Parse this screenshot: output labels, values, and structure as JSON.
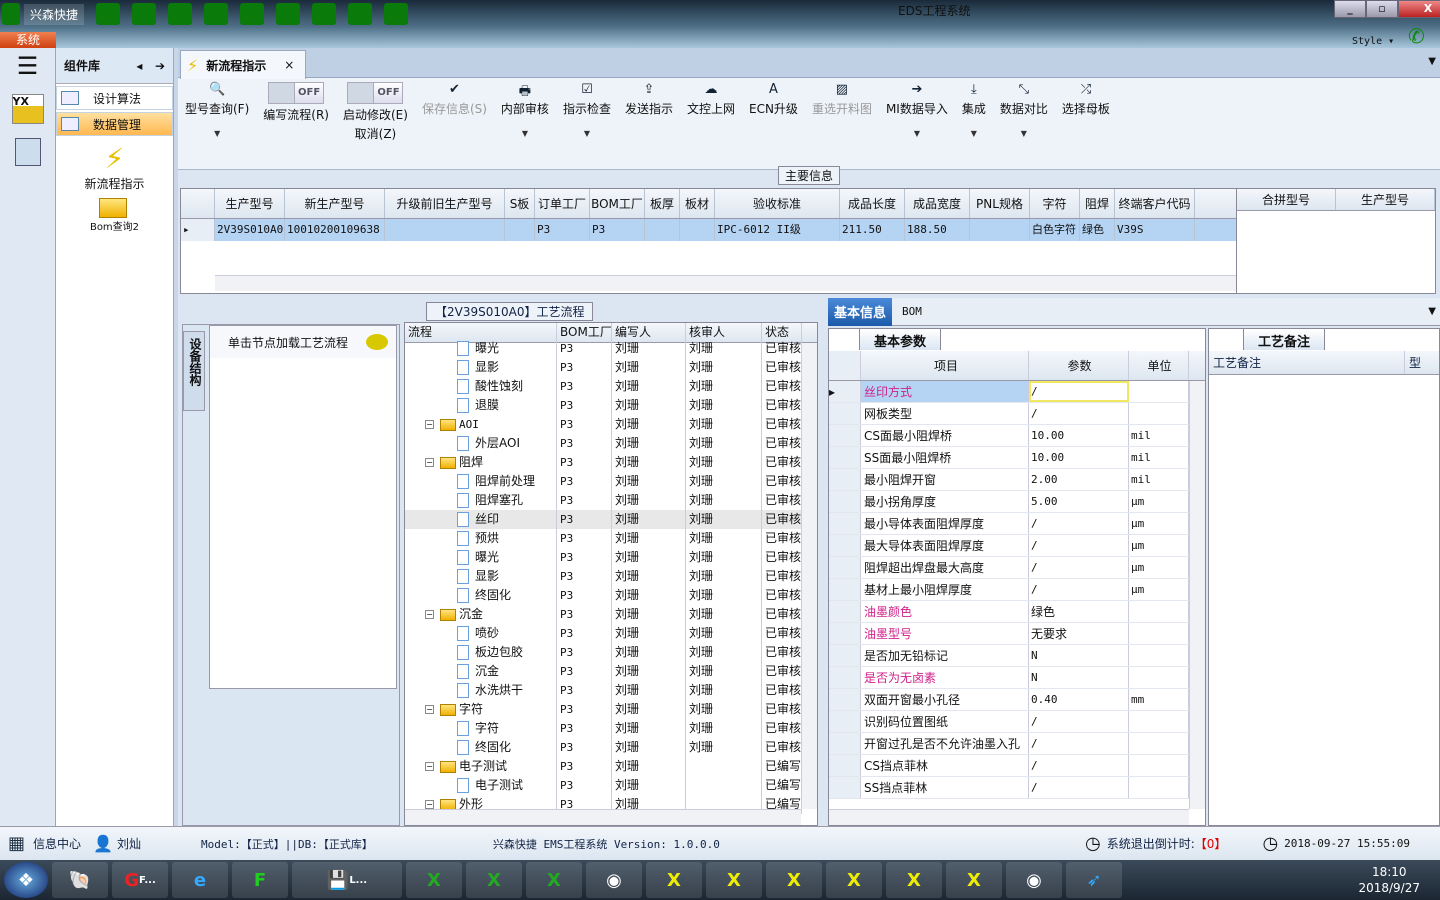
{
  "window": {
    "app_name": "兴森快捷",
    "title": "EDS工程系统",
    "system_tab": "系统",
    "style_label": "Style",
    "minimize": "_",
    "restore": "▫",
    "close": "X"
  },
  "quick_access_icons": [
    "search-icon",
    "lifebuoy-icon",
    "grid-icon",
    "scissors-icon",
    "film-icon",
    "copy-icon",
    "table-icon",
    "user-icon",
    "area-chart-icon"
  ],
  "component_panel": {
    "title": "组件库",
    "items": [
      {
        "label": "设计算法"
      },
      {
        "label": "数据管理",
        "selected": true
      }
    ],
    "big_items": [
      {
        "label": "新流程指示",
        "icon": "lightning-icon"
      },
      {
        "label": "Bom查询2",
        "icon": "folder-icon"
      }
    ]
  },
  "tab": {
    "label": "新流程指示",
    "close": "×"
  },
  "ribbon": {
    "buttons": [
      {
        "label": "型号查询(F)",
        "icon": "🔍",
        "dropdown": true
      },
      {
        "label": "编写流程(R)",
        "toggle": "OFF"
      },
      {
        "label": "启动修改(E)",
        "label2": "取消(Z)",
        "toggle": "OFF"
      },
      {
        "label": "保存信息(S)",
        "icon": "✔",
        "disabled": true
      },
      {
        "label": "内部审核",
        "icon": "🖶",
        "dropdown": true
      },
      {
        "label": "指示检查",
        "icon": "☑",
        "dropdown": true
      },
      {
        "label": "发送指示",
        "icon": "⇪"
      },
      {
        "label": "文控上网",
        "icon": "☁"
      },
      {
        "label": "ECN升级",
        "icon": "A"
      },
      {
        "label": "重选开料图",
        "icon": "▨",
        "disabled": true
      },
      {
        "label": "MI数据导入",
        "icon": "➔",
        "dropdown": true
      },
      {
        "label": "集成",
        "icon": "⤓",
        "dropdown": true
      },
      {
        "label": "数据对比",
        "icon": "⤡",
        "dropdown": true
      },
      {
        "label": "选择母板",
        "icon": "⤮"
      }
    ]
  },
  "main_info": {
    "group_label": "主要信息",
    "columns": [
      "生产型号",
      "新生产型号",
      "升级前旧生产型号",
      "S板",
      "订单工厂",
      "BOM工厂",
      "板厚",
      "板材",
      "验收标准",
      "成品长度",
      "成品宽度",
      "PNL规格",
      "字符",
      "阻焊",
      "终端客户代码"
    ],
    "rows": [
      [
        "2V39S010A0",
        "10010200109638",
        "",
        "",
        "P3",
        "P3",
        "",
        "",
        "IPC-6012 II级",
        "211.50",
        "188.50",
        "",
        "白色字符",
        "绿色",
        "V39S"
      ]
    ],
    "side_columns": [
      "合拼型号",
      "生产型号"
    ]
  },
  "process": {
    "title": "【2V39S010A0】工艺流程",
    "side_tab": "设备结构",
    "node_label": "单击节点加载工艺流程",
    "columns": [
      "流程",
      "BOM工厂",
      "编写人",
      "核审人",
      "状态"
    ],
    "rows": [
      {
        "name": "曝光",
        "folder": false,
        "bom": "P3",
        "writer": "刘珊",
        "reviewer": "刘珊",
        "status": "已审核"
      },
      {
        "name": "显影",
        "folder": false,
        "bom": "P3",
        "writer": "刘珊",
        "reviewer": "刘珊",
        "status": "已审核"
      },
      {
        "name": "酸性蚀刻",
        "folder": false,
        "bom": "P3",
        "writer": "刘珊",
        "reviewer": "刘珊",
        "status": "已审核"
      },
      {
        "name": "退膜",
        "folder": false,
        "bom": "P3",
        "writer": "刘珊",
        "reviewer": "刘珊",
        "status": "已审核"
      },
      {
        "name": "AOI",
        "folder": true,
        "bom": "P3",
        "writer": "刘珊",
        "reviewer": "刘珊",
        "status": "已审核"
      },
      {
        "name": "外层AOI",
        "folder": false,
        "bom": "P3",
        "writer": "刘珊",
        "reviewer": "刘珊",
        "status": "已审核"
      },
      {
        "name": "阻焊",
        "folder": true,
        "bom": "P3",
        "writer": "刘珊",
        "reviewer": "刘珊",
        "status": "已审核"
      },
      {
        "name": "阻焊前处理",
        "folder": false,
        "bom": "P3",
        "writer": "刘珊",
        "reviewer": "刘珊",
        "status": "已审核"
      },
      {
        "name": "阻焊塞孔",
        "folder": false,
        "bom": "P3",
        "writer": "刘珊",
        "reviewer": "刘珊",
        "status": "已审核"
      },
      {
        "name": "丝印",
        "folder": false,
        "bom": "P3",
        "writer": "刘珊",
        "reviewer": "刘珊",
        "status": "已审核",
        "selected": true
      },
      {
        "name": "预烘",
        "folder": false,
        "bom": "P3",
        "writer": "刘珊",
        "reviewer": "刘珊",
        "status": "已审核"
      },
      {
        "name": "曝光",
        "folder": false,
        "bom": "P3",
        "writer": "刘珊",
        "reviewer": "刘珊",
        "status": "已审核"
      },
      {
        "name": "显影",
        "folder": false,
        "bom": "P3",
        "writer": "刘珊",
        "reviewer": "刘珊",
        "status": "已审核"
      },
      {
        "name": "终固化",
        "folder": false,
        "bom": "P3",
        "writer": "刘珊",
        "reviewer": "刘珊",
        "status": "已审核"
      },
      {
        "name": "沉金",
        "folder": true,
        "bom": "P3",
        "writer": "刘珊",
        "reviewer": "刘珊",
        "status": "已审核"
      },
      {
        "name": "喷砂",
        "folder": false,
        "bom": "P3",
        "writer": "刘珊",
        "reviewer": "刘珊",
        "status": "已审核"
      },
      {
        "name": "板边包胶",
        "folder": false,
        "bom": "P3",
        "writer": "刘珊",
        "reviewer": "刘珊",
        "status": "已审核"
      },
      {
        "name": "沉金",
        "folder": false,
        "bom": "P3",
        "writer": "刘珊",
        "reviewer": "刘珊",
        "status": "已审核"
      },
      {
        "name": "水洗烘干",
        "folder": false,
        "bom": "P3",
        "writer": "刘珊",
        "reviewer": "刘珊",
        "status": "已审核"
      },
      {
        "name": "字符",
        "folder": true,
        "bom": "P3",
        "writer": "刘珊",
        "reviewer": "刘珊",
        "status": "已审核"
      },
      {
        "name": "字符",
        "folder": false,
        "bom": "P3",
        "writer": "刘珊",
        "reviewer": "刘珊",
        "status": "已审核"
      },
      {
        "name": "终固化",
        "folder": false,
        "bom": "P3",
        "writer": "刘珊",
        "reviewer": "刘珊",
        "status": "已审核"
      },
      {
        "name": "电子测试",
        "folder": true,
        "bom": "P3",
        "writer": "刘珊",
        "reviewer": "",
        "status": "已编写"
      },
      {
        "name": "电子测试",
        "folder": false,
        "bom": "P3",
        "writer": "刘珊",
        "reviewer": "",
        "status": "已编写"
      },
      {
        "name": "外形",
        "folder": true,
        "bom": "P3",
        "writer": "刘珊",
        "reviewer": "",
        "status": "已编写"
      }
    ]
  },
  "detail": {
    "tabs": [
      "基本信息",
      "BOM"
    ],
    "params_tab": "基本参数",
    "notes_tab": "工艺备注",
    "notes_columns": [
      "工艺备注",
      "型"
    ],
    "param_columns": [
      "项目",
      "参数",
      "单位"
    ],
    "params": [
      {
        "item": "丝印方式",
        "value": "/",
        "unit": "",
        "pink": true,
        "selected": true
      },
      {
        "item": "网板类型",
        "value": "/",
        "unit": ""
      },
      {
        "item": "CS面最小阻焊桥",
        "value": "10.00",
        "unit": "mil"
      },
      {
        "item": "SS面最小阻焊桥",
        "value": "10.00",
        "unit": "mil"
      },
      {
        "item": "最小阻焊开窗",
        "value": "2.00",
        "unit": "mil"
      },
      {
        "item": "最小拐角厚度",
        "value": "5.00",
        "unit": "µm"
      },
      {
        "item": "最小导体表面阻焊厚度",
        "value": "/",
        "unit": "µm"
      },
      {
        "item": "最大导体表面阻焊厚度",
        "value": "/",
        "unit": "µm"
      },
      {
        "item": "阻焊超出焊盘最大高度",
        "value": "/",
        "unit": "µm"
      },
      {
        "item": "基材上最小阻焊厚度",
        "value": "/",
        "unit": "µm"
      },
      {
        "item": "油墨颜色",
        "value": "绿色",
        "unit": "",
        "pink": true
      },
      {
        "item": "油墨型号",
        "value": "无要求",
        "unit": "",
        "pink": true
      },
      {
        "item": "是否加无铅标记",
        "value": "N",
        "unit": ""
      },
      {
        "item": "是否为无卤素",
        "value": "N",
        "unit": "",
        "pink": true
      },
      {
        "item": "双面开窗最小孔径",
        "value": "0.40",
        "unit": "mm"
      },
      {
        "item": "识别码位置图纸",
        "value": "/",
        "unit": ""
      },
      {
        "item": "开窗过孔是否不允许油墨入孔",
        "value": "/",
        "unit": ""
      },
      {
        "item": "CS挡点菲林",
        "value": "/",
        "unit": ""
      },
      {
        "item": "SS挡点菲林",
        "value": "/",
        "unit": ""
      }
    ]
  },
  "status": {
    "info_center": "信息中心",
    "user": "刘灿",
    "model": "Model:【正式】||DB:【正式库】",
    "version": "兴森快捷 EMS工程系统 Version: 1.0.0.0",
    "countdown_label": "系统退出倒计时:",
    "countdown_value": "【0】",
    "datetime": "2018-09-27 15:55:09"
  },
  "taskbar": {
    "items": [
      "F...",
      "L..."
    ],
    "time": "18:10",
    "date": "2018/9/27"
  },
  "colors": {
    "accent": "#1a5aa8",
    "selected_row": "#b5d3f3",
    "pink_label": "#d0208a",
    "countdown": "#e00000"
  }
}
